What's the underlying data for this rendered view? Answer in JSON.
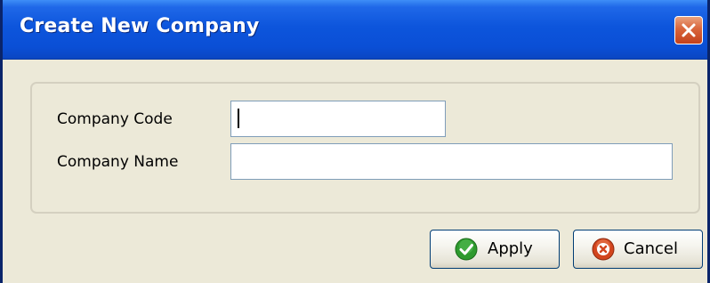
{
  "window": {
    "title": "Create New Company",
    "close_icon": "close-x-icon"
  },
  "form": {
    "company_code": {
      "label": "Company Code",
      "value": ""
    },
    "company_name": {
      "label": "Company Name",
      "value": ""
    }
  },
  "buttons": {
    "apply": {
      "label": "Apply",
      "icon": "green-check-icon"
    },
    "cancel": {
      "label": "Cancel",
      "icon": "red-cancel-icon"
    }
  },
  "colors": {
    "titlebar": "#0a4fd6",
    "close_button": "#d9653b",
    "window_background": "#ece9d8"
  }
}
